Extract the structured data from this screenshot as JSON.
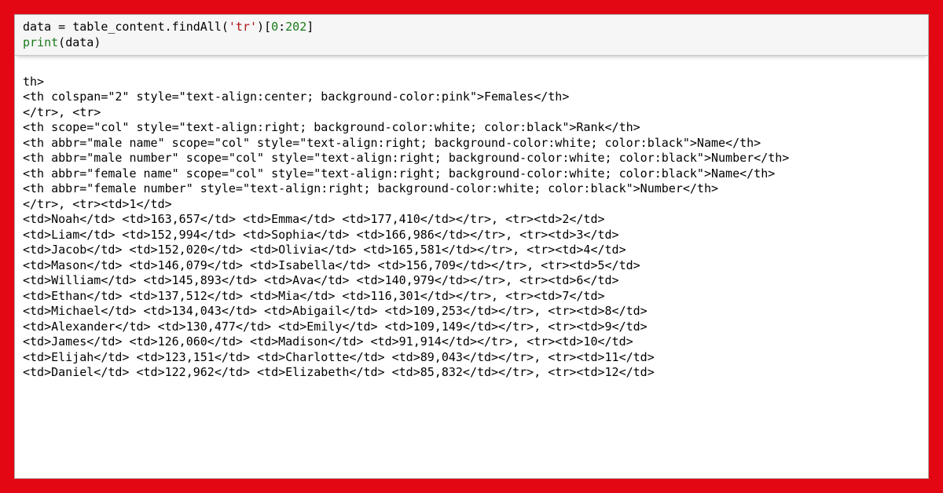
{
  "code": {
    "line1": {
      "var": "data",
      "eq": " = ",
      "obj": "table_content",
      "dot": ".",
      "method": "findAll",
      "open": "(",
      "arg_str": "'tr'",
      "close": ")",
      "slice": "[",
      "slice_start": "0",
      "colon": ":",
      "slice_end": "202",
      "slice_close": "]"
    },
    "line2": {
      "builtin": "print",
      "open": "(",
      "arg": "data",
      "close": ")"
    }
  },
  "output": {
    "truncated_top": "th>",
    "header_females": "<th colspan=\"2\" style=\"text-align:center; background-color:pink\">Females</th>",
    "close_tr_open": "</tr>, <tr>",
    "col_rank": "<th scope=\"col\" style=\"text-align:right; background-color:white; color:black\">Rank</th>",
    "col_male_name": "<th abbr=\"male name\" scope=\"col\" style=\"text-align:right; background-color:white; color:black\">Name</th>",
    "col_male_num": "<th abbr=\"male number\" scope=\"col\" style=\"text-align:right; background-color:white; color:black\">Number</th>",
    "col_female_name": "<th abbr=\"female name\" scope=\"col\" style=\"text-align:right; background-color:white; color:black\">Name</th>",
    "col_female_num": "<th abbr=\"female number\" style=\"text-align:right; background-color:white; color:black\">Number</th>",
    "close_tr_first_row": "</tr>, <tr><td>1</td>",
    "rows": [
      {
        "male_name": "Noah",
        "male_num": "163,657",
        "female_name": "Emma",
        "female_num": "177,410",
        "next_rank": "2"
      },
      {
        "male_name": "Liam",
        "male_num": "152,994",
        "female_name": "Sophia",
        "female_num": "166,986",
        "next_rank": "3"
      },
      {
        "male_name": "Jacob",
        "male_num": "152,020",
        "female_name": "Olivia",
        "female_num": "165,581",
        "next_rank": "4"
      },
      {
        "male_name": "Mason",
        "male_num": "146,079",
        "female_name": "Isabella",
        "female_num": "156,709",
        "next_rank": "5"
      },
      {
        "male_name": "William",
        "male_num": "145,893",
        "female_name": "Ava",
        "female_num": "140,979",
        "next_rank": "6"
      },
      {
        "male_name": "Ethan",
        "male_num": "137,512",
        "female_name": "Mia",
        "female_num": "116,301",
        "next_rank": "7"
      },
      {
        "male_name": "Michael",
        "male_num": "134,043",
        "female_name": "Abigail",
        "female_num": "109,253",
        "next_rank": "8"
      },
      {
        "male_name": "Alexander",
        "male_num": "130,477",
        "female_name": "Emily",
        "female_num": "109,149",
        "next_rank": "9"
      },
      {
        "male_name": "James",
        "male_num": "126,060",
        "female_name": "Madison",
        "female_num": "91,914",
        "next_rank": "10"
      },
      {
        "male_name": "Elijah",
        "male_num": "123,151",
        "female_name": "Charlotte",
        "female_num": "89,043",
        "next_rank": "11"
      },
      {
        "male_name": "Daniel",
        "male_num": "122,962",
        "female_name": "Elizabeth",
        "female_num": "85,832",
        "next_rank": "12"
      }
    ],
    "row_template": "<td>{male_name}</td> <td>{male_num}</td> <td>{female_name}</td> <td>{female_num}</td></tr>, <tr><td>{next_rank}</td>"
  }
}
